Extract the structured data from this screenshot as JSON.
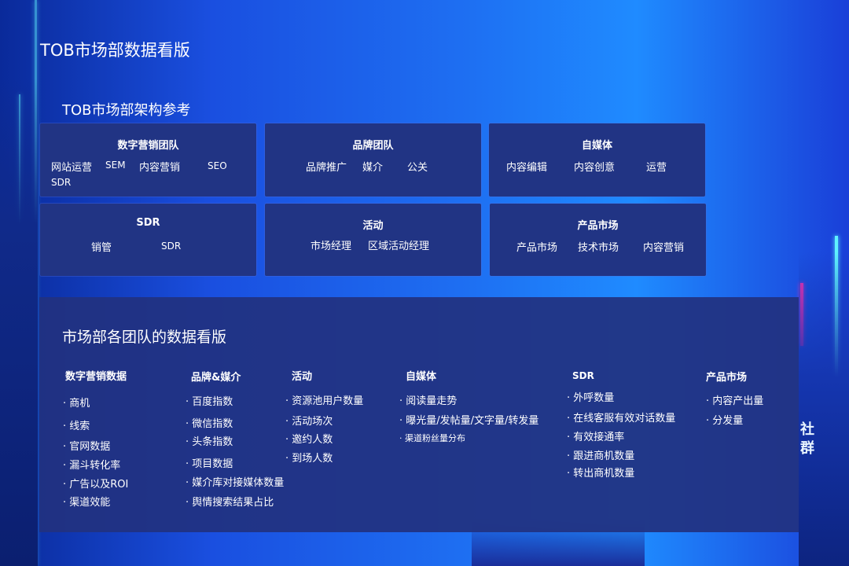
{
  "page_title": "TOB市场部数据看版",
  "org_section_title": "TOB市场部架构参考",
  "org_cards": [
    {
      "title": "数字营销团队",
      "items": [
        "网站运营",
        "SEM",
        "内容营销",
        "SEO",
        "SDR"
      ]
    },
    {
      "title": "品牌团队",
      "items": [
        "品牌推广",
        "媒介",
        "公关"
      ]
    },
    {
      "title": "自媒体",
      "items": [
        "内容编辑",
        "内容创意",
        "运营"
      ]
    },
    {
      "title": "SDR",
      "items": [
        "销管",
        "SDR"
      ]
    },
    {
      "title": "活动",
      "items": [
        "市场经理",
        "区域活动经理"
      ]
    },
    {
      "title": "产品市场",
      "items": [
        "产品市场",
        "技术市场",
        "内容营销"
      ]
    }
  ],
  "dashboard_title": "市场部各团队的数据看版",
  "dashboard_columns": [
    {
      "title": "数字营销数据",
      "metrics": [
        "· 商机",
        "· 线索",
        "· 官网数据",
        "· 漏斗转化率",
        "· 广告以及ROI",
        "· 渠道效能"
      ]
    },
    {
      "title": "品牌&媒介",
      "metrics": [
        "· 百度指数",
        "· 微信指数",
        "· 头条指数",
        "· 项目数据",
        "· 媒介库对接媒体数量",
        "· 舆情搜索结果占比"
      ]
    },
    {
      "title": "活动",
      "metrics": [
        "· 资源池用户数量",
        "· 活动场次",
        "· 邀约人数",
        "· 到场人数"
      ]
    },
    {
      "title": "自媒体",
      "metrics": [
        "· 阅读量走势",
        "· 曝光量/发帖量/文字量/转发量",
        "· 渠道粉丝量分布"
      ]
    },
    {
      "title": "SDR",
      "metrics": [
        "· 外呼数量",
        "· 在线客服有效对话数量",
        "· 有效接通率",
        "· 跟进商机数量",
        "· 转出商机数量"
      ]
    },
    {
      "title": "产品市场",
      "metrics": [
        "· 内容产出量",
        "· 分发量"
      ]
    }
  ],
  "side_text": "社群",
  "colors": {
    "card_bg": "#213484",
    "accent_neon": "#5ff3ff",
    "accent_pink": "#ff2fb0"
  }
}
